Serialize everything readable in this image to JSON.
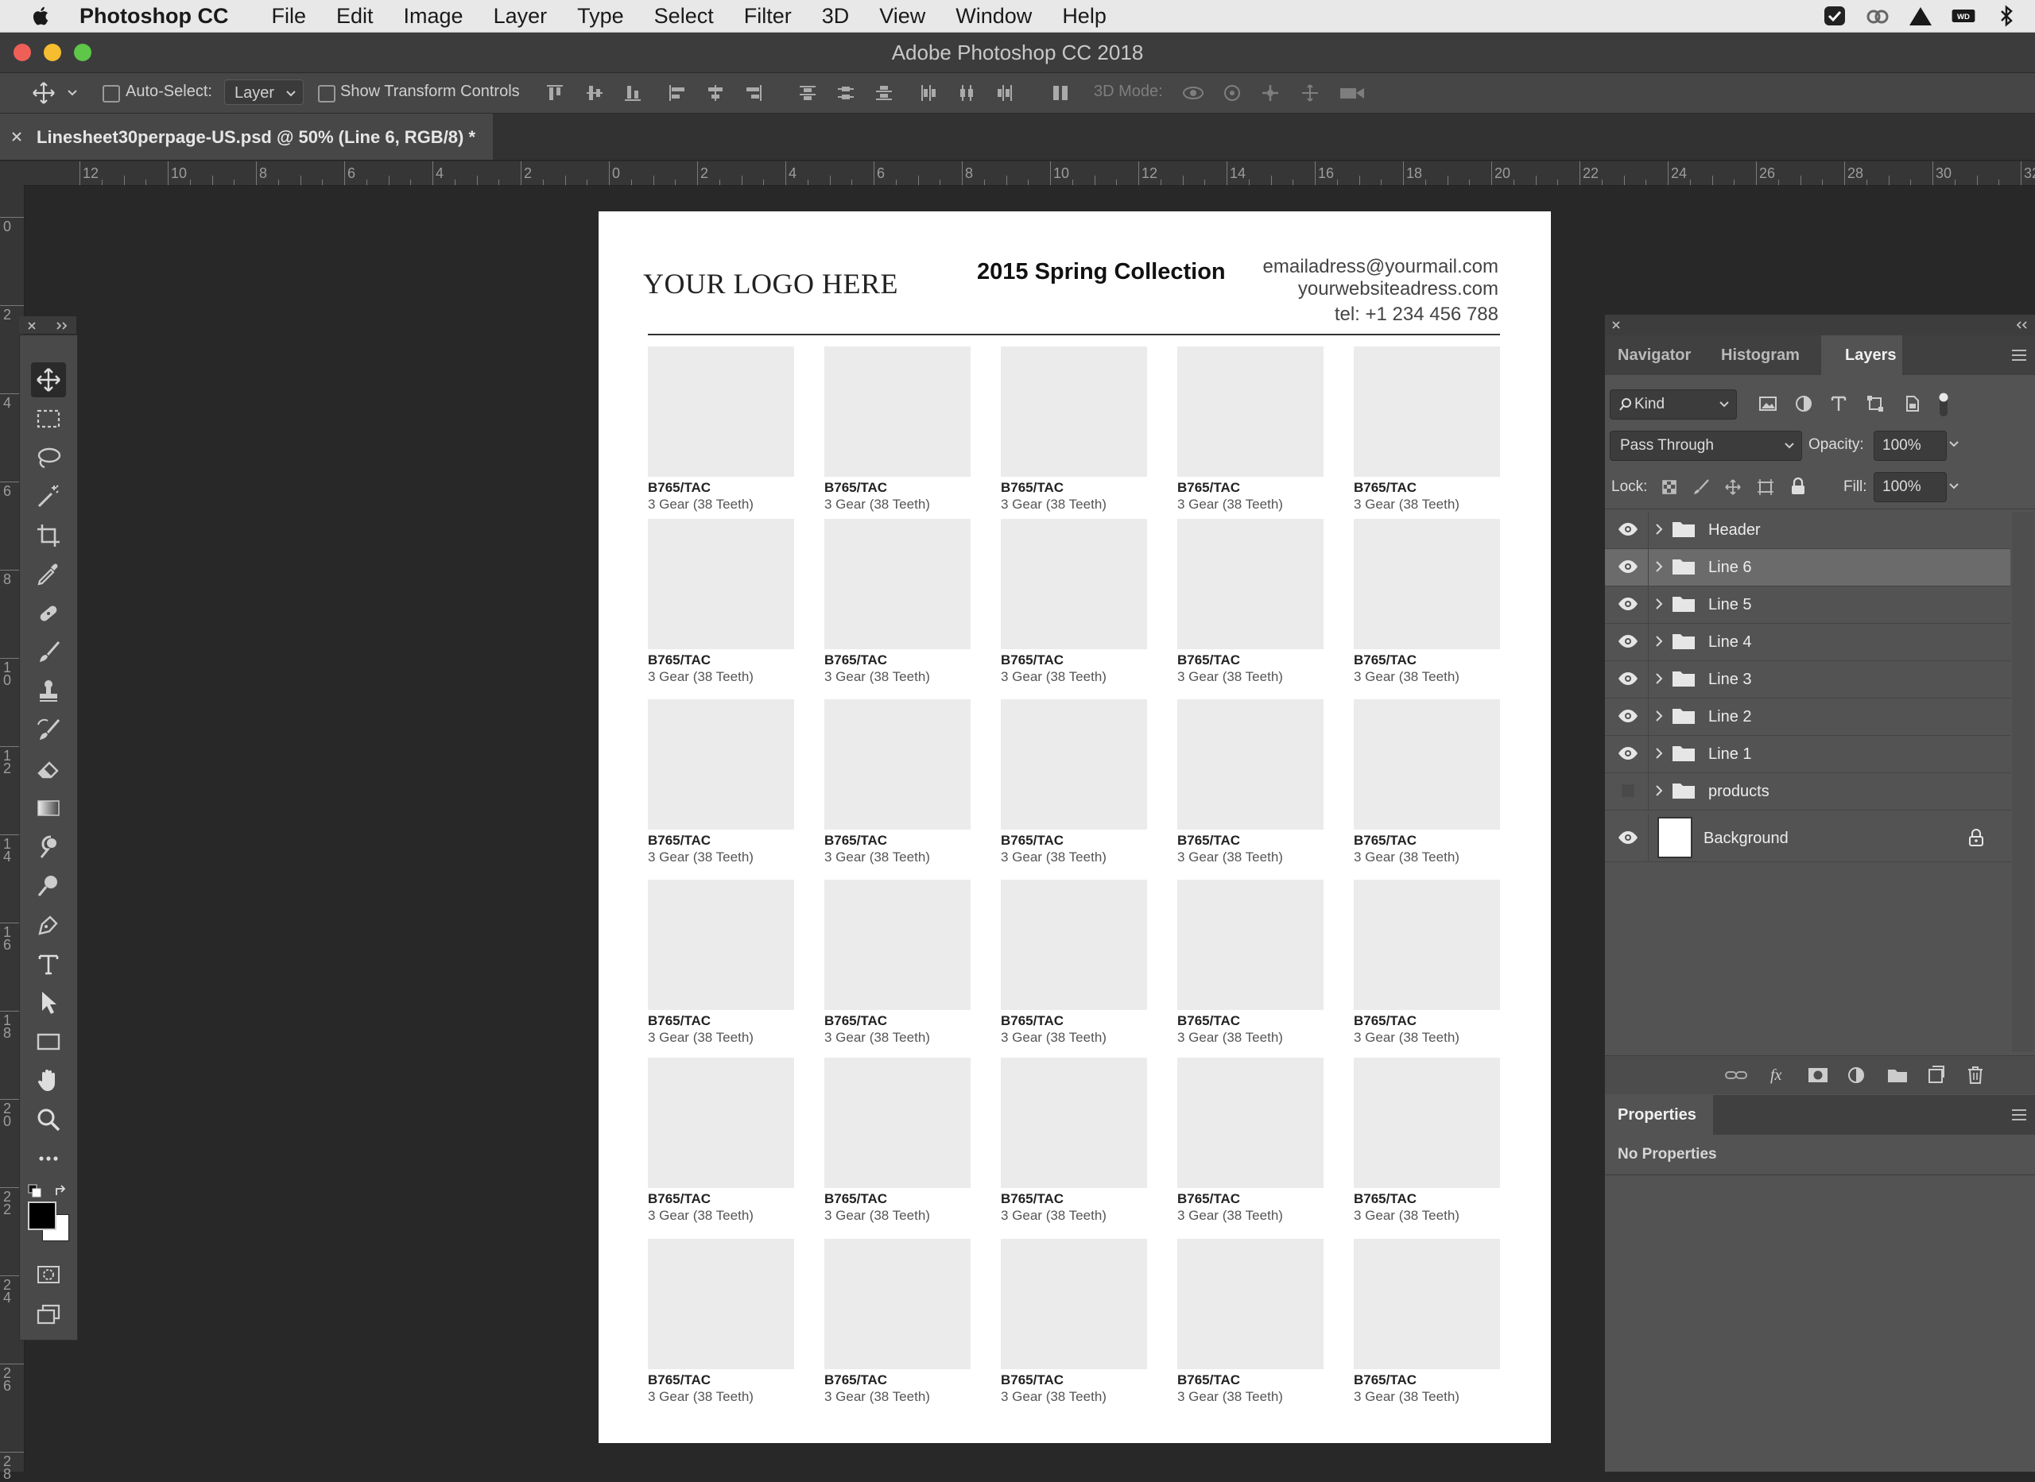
{
  "menubar": {
    "app": "Photoshop CC",
    "items": [
      "File",
      "Edit",
      "Image",
      "Layer",
      "Type",
      "Select",
      "Filter",
      "3D",
      "View",
      "Window",
      "Help"
    ]
  },
  "window": {
    "title": "Adobe Photoshop CC 2018"
  },
  "options": {
    "auto_select_label": "Auto-Select:",
    "auto_select_value": "Layer",
    "show_transform_label": "Show Transform Controls",
    "mode_3d_label": "3D Mode:"
  },
  "document": {
    "tab_title": "Linesheet30perpage-US.psd @ 50% (Line 6, RGB/8) *"
  },
  "rulers": {
    "horizontal": [
      "12",
      "10",
      "8",
      "6",
      "4",
      "2",
      "0",
      "2",
      "4",
      "6",
      "8",
      "10",
      "12",
      "14",
      "16",
      "18",
      "20",
      "22",
      "24",
      "26",
      "28",
      "30",
      "32"
    ],
    "vertical": [
      "0",
      "2",
      "4",
      "6",
      "8",
      "10",
      "12",
      "14",
      "16",
      "18",
      "20",
      "22",
      "24",
      "26",
      "28"
    ]
  },
  "page": {
    "logo": "YOUR LOGO HERE",
    "collection": "2015 Spring Collection",
    "email": "emailadress@yourmail.com",
    "website": "yourwebsiteadress.com",
    "tel": "tel: +1 234 456 788",
    "product_code": "B765/TAC",
    "product_desc": "3 Gear (38 Teeth)"
  },
  "panels": {
    "tabs": [
      "Navigator",
      "Histogram",
      "Layers"
    ],
    "active_tab": "Layers",
    "filter_kind": "Kind",
    "blend_mode": "Pass Through",
    "opacity_label": "Opacity:",
    "opacity_value": "100%",
    "lock_label": "Lock:",
    "fill_label": "Fill:",
    "fill_value": "100%",
    "layers": [
      {
        "name": "Header",
        "visible": true,
        "selected": false,
        "type": "group"
      },
      {
        "name": "Line 6",
        "visible": true,
        "selected": true,
        "type": "group"
      },
      {
        "name": "Line 5",
        "visible": true,
        "selected": false,
        "type": "group"
      },
      {
        "name": "Line 4",
        "visible": true,
        "selected": false,
        "type": "group"
      },
      {
        "name": "Line 3",
        "visible": true,
        "selected": false,
        "type": "group"
      },
      {
        "name": "Line 2",
        "visible": true,
        "selected": false,
        "type": "group"
      },
      {
        "name": "Line 1",
        "visible": true,
        "selected": false,
        "type": "group"
      },
      {
        "name": "products",
        "visible": false,
        "selected": false,
        "type": "group"
      },
      {
        "name": "Background",
        "visible": true,
        "selected": false,
        "type": "layer",
        "locked": true
      }
    ],
    "properties_tab": "Properties",
    "properties_text": "No Properties"
  },
  "colors": {
    "foreground": "#000000",
    "background": "#ffffff",
    "selected_layer": "#6b6b6b"
  },
  "icons": {
    "tools": [
      "move-icon",
      "rectangular-marquee-icon",
      "lasso-icon",
      "magic-wand-icon",
      "crop-icon",
      "eyedropper-icon",
      "healing-brush-icon",
      "brush-icon",
      "clone-stamp-icon",
      "history-brush-icon",
      "eraser-icon",
      "gradient-icon",
      "blur-icon",
      "dodge-icon",
      "pen-icon",
      "type-icon",
      "path-selection-icon",
      "rectangle-icon",
      "hand-icon",
      "zoom-icon",
      "more-tools-icon"
    ]
  }
}
